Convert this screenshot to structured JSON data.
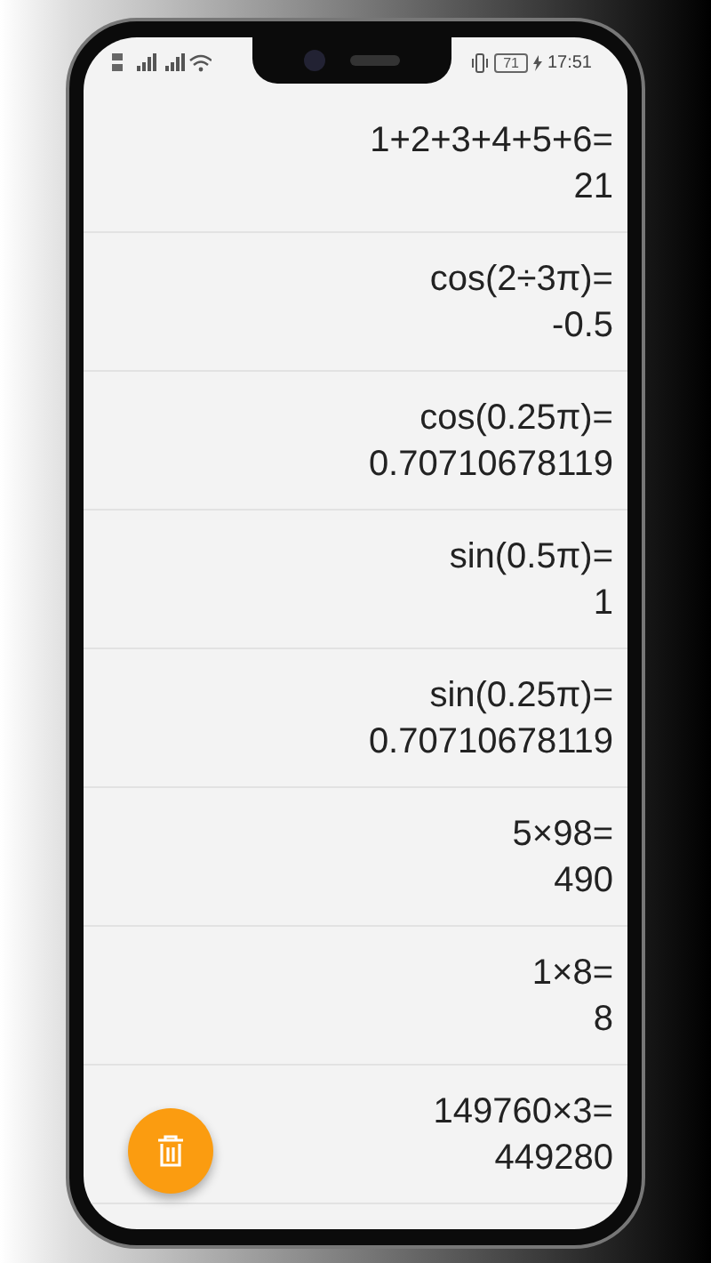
{
  "status_bar": {
    "battery": "71",
    "time": "17:51"
  },
  "history": [
    {
      "expression": "1+2+3+4+5+6=",
      "result": "21"
    },
    {
      "expression": "cos(2÷3π)=",
      "result": "-0.5"
    },
    {
      "expression": "cos(0.25π)=",
      "result": "0.70710678119"
    },
    {
      "expression": "sin(0.5π)=",
      "result": "1"
    },
    {
      "expression": "sin(0.25π)=",
      "result": "0.70710678119"
    },
    {
      "expression": "5×98=",
      "result": "490"
    },
    {
      "expression": "1×8=",
      "result": "8"
    },
    {
      "expression": "149760×3=",
      "result": "449280"
    }
  ]
}
